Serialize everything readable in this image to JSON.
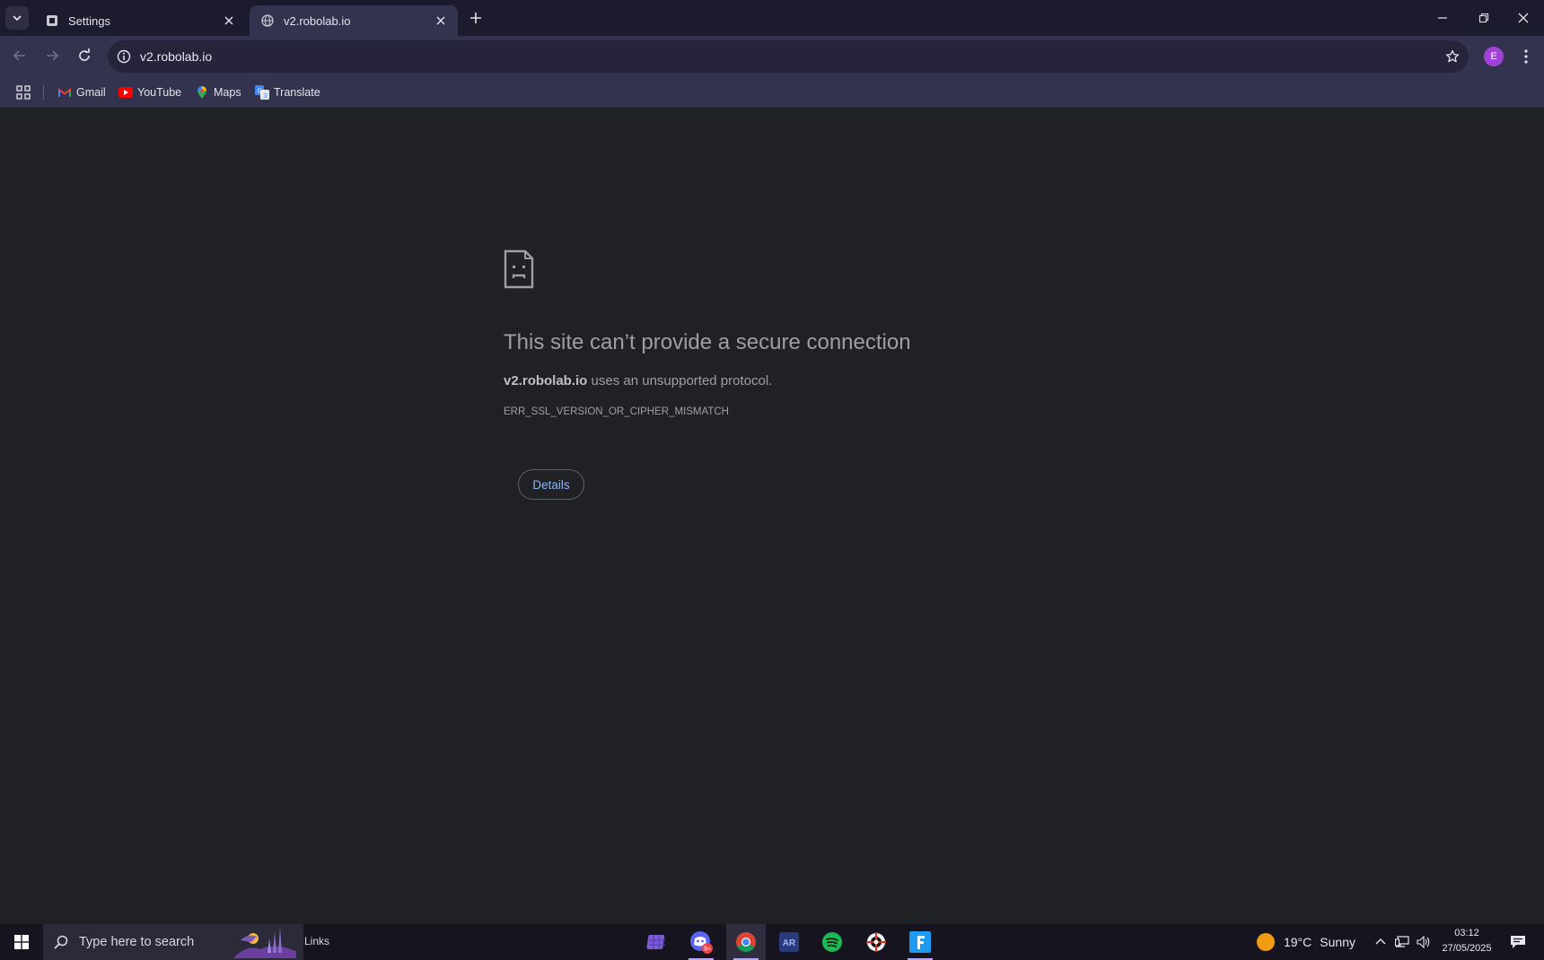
{
  "browser": {
    "tabs": [
      {
        "title": "Settings",
        "icon": "settings-favicon"
      },
      {
        "title": "v2.robolab.io",
        "icon": "globe-icon",
        "active": true
      }
    ],
    "address": "v2.robolab.io",
    "profile_initial": "E",
    "bookmarks": [
      {
        "label": "Gmail",
        "icon": "gmail-icon"
      },
      {
        "label": "YouTube",
        "icon": "youtube-icon"
      },
      {
        "label": "Maps",
        "icon": "maps-icon"
      },
      {
        "label": "Translate",
        "icon": "translate-icon"
      }
    ]
  },
  "error_page": {
    "title": "This site can’t provide a secure connection",
    "host": "v2.robolab.io",
    "description_rest": " uses an unsupported protocol.",
    "code": "ERR_SSL_VERSION_OR_CIPHER_MISMATCH",
    "details_button": "Details"
  },
  "taskbar": {
    "search_placeholder": "Type here to search",
    "links_label": "Links",
    "apps": [
      "app-grid-icon",
      "discord-icon",
      "chrome-icon",
      "ar-app-icon",
      "spotify-icon",
      "target-app-icon",
      "f-app-icon"
    ],
    "discord_badge": "9+",
    "weather": {
      "temp": "19°C",
      "condition": "Sunny"
    },
    "time": "03:12",
    "date": "27/05/2025"
  },
  "colors": {
    "tab_strip": "#1c1b2e",
    "toolbar": "#34334f",
    "content_bg": "#202124",
    "link_blue": "#8ab4f8",
    "avatar": "#a142d6"
  }
}
